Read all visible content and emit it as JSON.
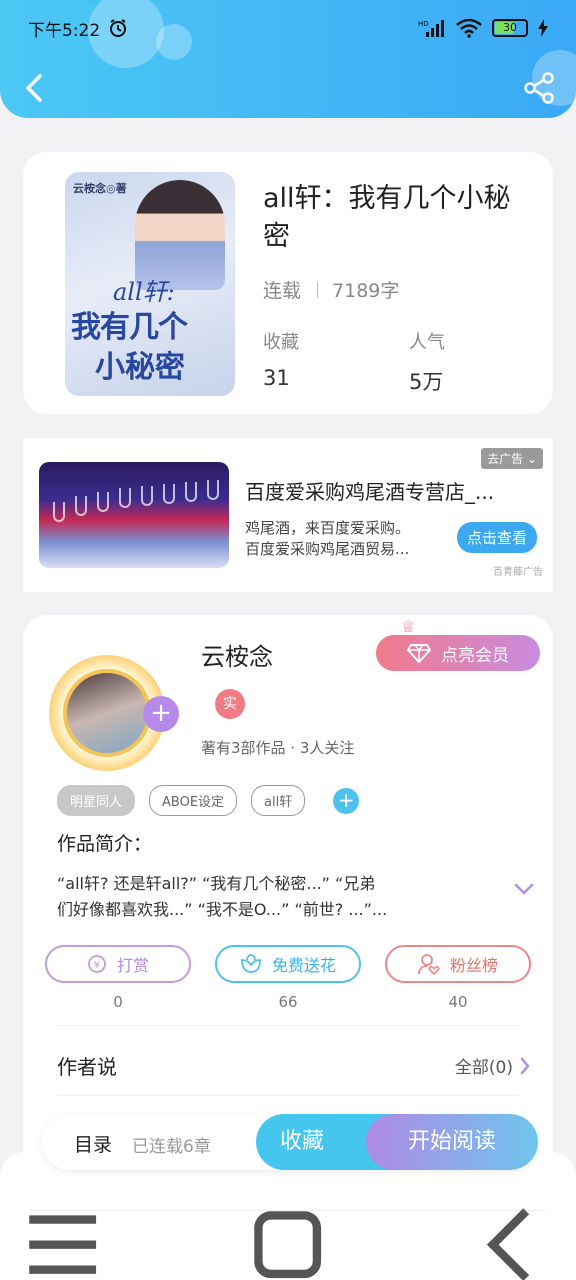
{
  "status_bar": {
    "time": "下午5:22",
    "battery": "30"
  },
  "book": {
    "title": "all轩：我有几个小秘密",
    "status": "连载",
    "word_count": "7189字",
    "favorites_label": "收藏",
    "favorites_value": "31",
    "popularity_label": "人气",
    "popularity_value": "5万",
    "cover": {
      "author_line": "云桉念◎著",
      "title_line1": "all轩:",
      "title_line2": "我有几个",
      "title_line3": "小秘密"
    }
  },
  "ad": {
    "close_label": "去广告",
    "title": "百度爱采购鸡尾酒专营店_...",
    "desc_line1": "鸡尾酒，来百度爱采购。",
    "desc_line2": "百度爱采购鸡尾酒贸易...",
    "button": "点击查看",
    "source": "百青藤广告"
  },
  "author": {
    "name": "云桉念",
    "vip_button": "点亮会员",
    "real_badge": "实",
    "stats": "著有3部作品 · 3人关注",
    "tags": [
      "明星同人",
      "ABOE设定",
      "all轩"
    ],
    "intro_label": "作品简介：",
    "intro_line1": "“all轩? 还是轩all?”     “我有几个秘密...”     “兄弟",
    "intro_line2": "们好像都喜欢我...”     “我不是O...”    “前世? ...”...",
    "actions": [
      {
        "label": "打赏",
        "count": "0",
        "color": "#c39be2"
      },
      {
        "label": "免费送花",
        "count": "66",
        "color": "#4ec2ee"
      },
      {
        "label": "粉丝榜",
        "count": "40",
        "color": "#ee8886"
      }
    ],
    "says_label": "作者说",
    "says_all": "全部(0)"
  },
  "bottom_bar": {
    "toc": "目录",
    "chapters": "已连载6章",
    "favorite": "收藏",
    "read": "开始阅读"
  }
}
